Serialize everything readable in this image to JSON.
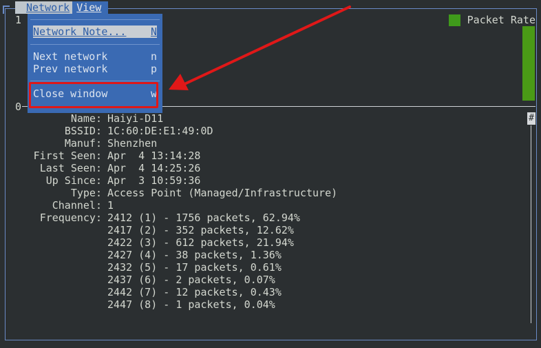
{
  "menubar": {
    "items": [
      {
        "label": "Network",
        "active": true
      },
      {
        "label": "View",
        "active": false
      }
    ]
  },
  "graph": {
    "axis_top": "1",
    "axis_bottom": "0",
    "legend_label": "Packet Rate",
    "legend_color": "#3f9a1b"
  },
  "dropdown": {
    "items": [
      {
        "label": "Network Note...",
        "shortcut": "N",
        "selected": true
      },
      {
        "label": "Next network",
        "shortcut": "n",
        "selected": false
      },
      {
        "label": "Prev network",
        "shortcut": "p",
        "selected": false
      },
      {
        "label": "Close window",
        "shortcut": "w",
        "selected": false
      }
    ]
  },
  "annotation": {
    "highlight_color": "#e01818",
    "highlighted_item": "Close window"
  },
  "scrollbar": {
    "marker": "#"
  },
  "details": {
    "rows": [
      {
        "key": "Name:",
        "value": "Haiyi-D11"
      },
      {
        "key": "BSSID:",
        "value": "1C:60:DE:E1:49:0D"
      },
      {
        "key": "Manuf:",
        "value": "Shenzhen"
      },
      {
        "key": "First Seen:",
        "value": "Apr  4 13:14:28"
      },
      {
        "key": "Last Seen:",
        "value": "Apr  4 14:25:26"
      },
      {
        "key": "Up Since:",
        "value": "Apr  3 10:59:36"
      },
      {
        "key": "Type:",
        "value": "Access Point (Managed/Infrastructure)"
      },
      {
        "key": "Channel:",
        "value": "1"
      },
      {
        "key": "Frequency:",
        "value": "2412 (1) - 1756 packets, 62.94%"
      },
      {
        "key": "",
        "value": "2417 (2) - 352 packets, 12.62%"
      },
      {
        "key": "",
        "value": "2422 (3) - 612 packets, 21.94%"
      },
      {
        "key": "",
        "value": "2427 (4) - 38 packets, 1.36%"
      },
      {
        "key": "",
        "value": "2432 (5) - 17 packets, 0.61%"
      },
      {
        "key": "",
        "value": "2437 (6) - 2 packets, 0.07%"
      },
      {
        "key": "",
        "value": "2442 (7) - 12 packets, 0.43%"
      },
      {
        "key": "",
        "value": "2447 (8) - 1 packets, 0.04%"
      }
    ]
  }
}
